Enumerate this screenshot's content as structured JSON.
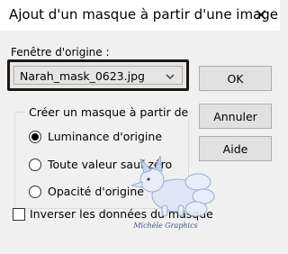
{
  "window": {
    "title": "Ajout d'un masque à partir d'une image",
    "close_icon": "close-icon"
  },
  "source": {
    "label": "Fenêtre d'origine :",
    "selected": "Narah_mask_0623.jpg",
    "chevron_icon": "chevron-down-icon"
  },
  "buttons": {
    "ok": "OK",
    "cancel": "Annuler",
    "help": "Aide"
  },
  "group": {
    "title": "Créer un masque à partir de",
    "options": [
      {
        "label": "Luminance d'origine",
        "checked": true
      },
      {
        "label": "Toute valeur sauf zéro",
        "checked": false
      },
      {
        "label": "Opacité d'origine",
        "checked": false
      }
    ]
  },
  "invert": {
    "label": "Inverser les données du masque",
    "checked": false
  },
  "watermark": {
    "text": "Michèle Graphics"
  },
  "colors": {
    "dialog_bg": "#f0f0f0",
    "button_bg": "#e1e1e1",
    "select_border": "#1a1714"
  }
}
